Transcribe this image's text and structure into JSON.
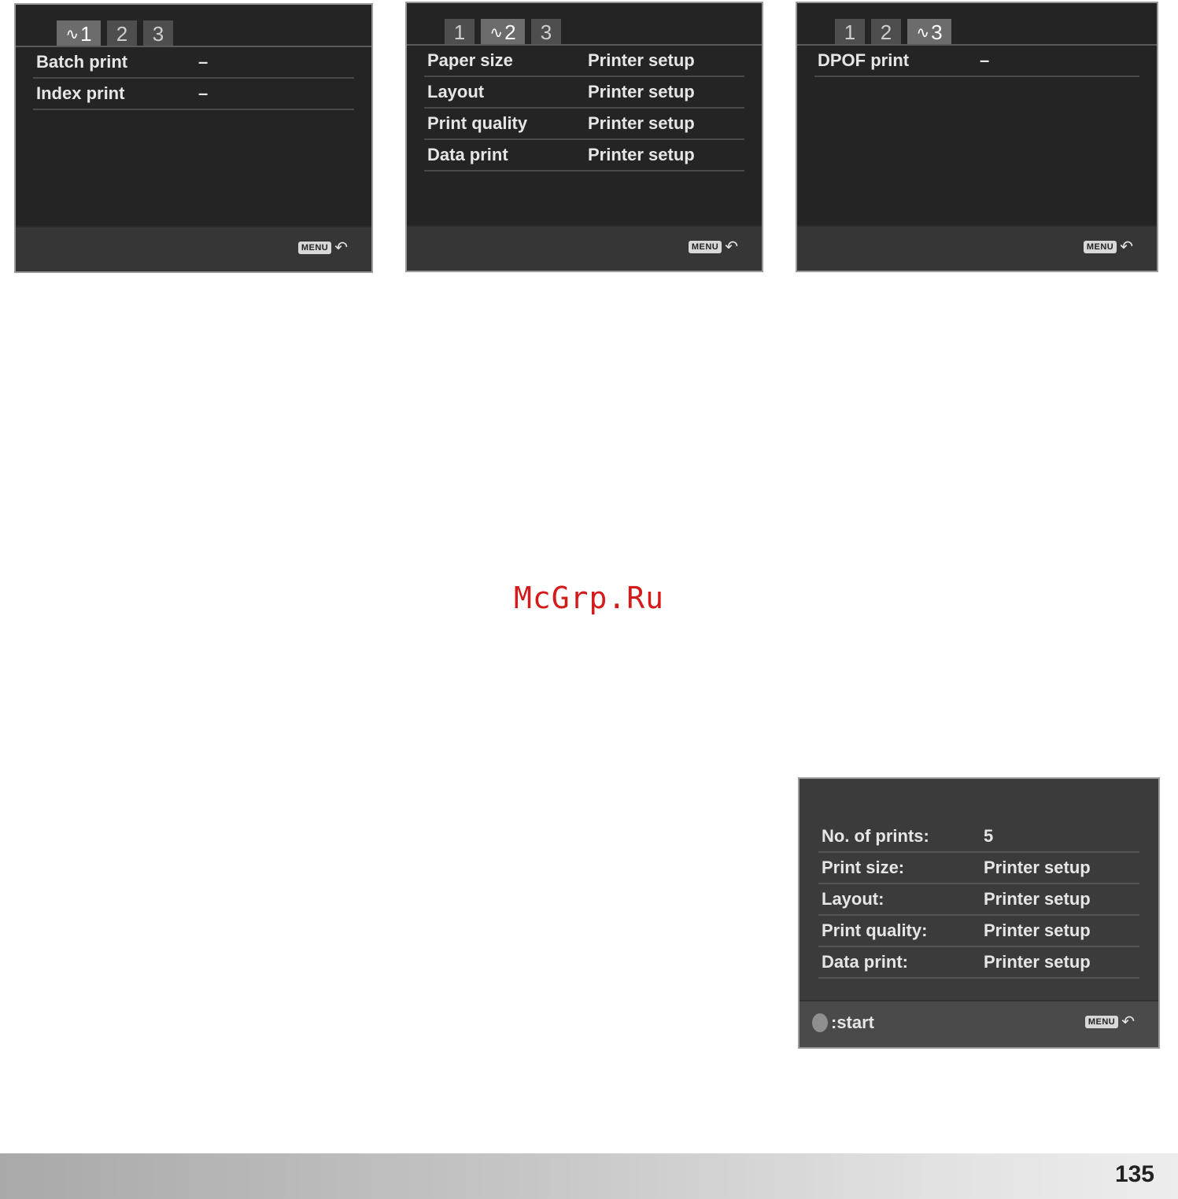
{
  "screens": [
    {
      "tabs": [
        {
          "label": "1",
          "active": true
        },
        {
          "label": "2",
          "active": false
        },
        {
          "label": "3",
          "active": false
        }
      ],
      "rows": [
        {
          "label": "Batch print",
          "value": "–"
        },
        {
          "label": "Index print",
          "value": "–"
        }
      ],
      "menu_badge": "MENU"
    },
    {
      "tabs": [
        {
          "label": "1",
          "active": false
        },
        {
          "label": "2",
          "active": true
        },
        {
          "label": "3",
          "active": false
        }
      ],
      "rows": [
        {
          "label": "Paper size",
          "value": "Printer setup"
        },
        {
          "label": "Layout",
          "value": "Printer setup"
        },
        {
          "label": "Print quality",
          "value": "Printer setup"
        },
        {
          "label": "Data print",
          "value": "Printer setup"
        }
      ],
      "menu_badge": "MENU"
    },
    {
      "tabs": [
        {
          "label": "1",
          "active": false
        },
        {
          "label": "2",
          "active": false
        },
        {
          "label": "3",
          "active": true
        }
      ],
      "rows": [
        {
          "label": "DPOF print",
          "value": "–"
        }
      ],
      "menu_badge": "MENU"
    },
    {
      "rows": [
        {
          "label": "No. of prints:",
          "value": "5"
        },
        {
          "label": "Print size:",
          "value": "Printer setup"
        },
        {
          "label": "Layout:",
          "value": "Printer setup"
        },
        {
          "label": "Print quality:",
          "value": "Printer setup"
        },
        {
          "label": "Data print:",
          "value": "Printer setup"
        }
      ],
      "start_label": ":start",
      "menu_badge": "MENU"
    }
  ],
  "watermark": "McGrp.Ru",
  "page_number": "135",
  "colors": {
    "watermark": "#d41a1a",
    "screen_bg": "#242424",
    "screen_text": "#e6e6e6"
  }
}
